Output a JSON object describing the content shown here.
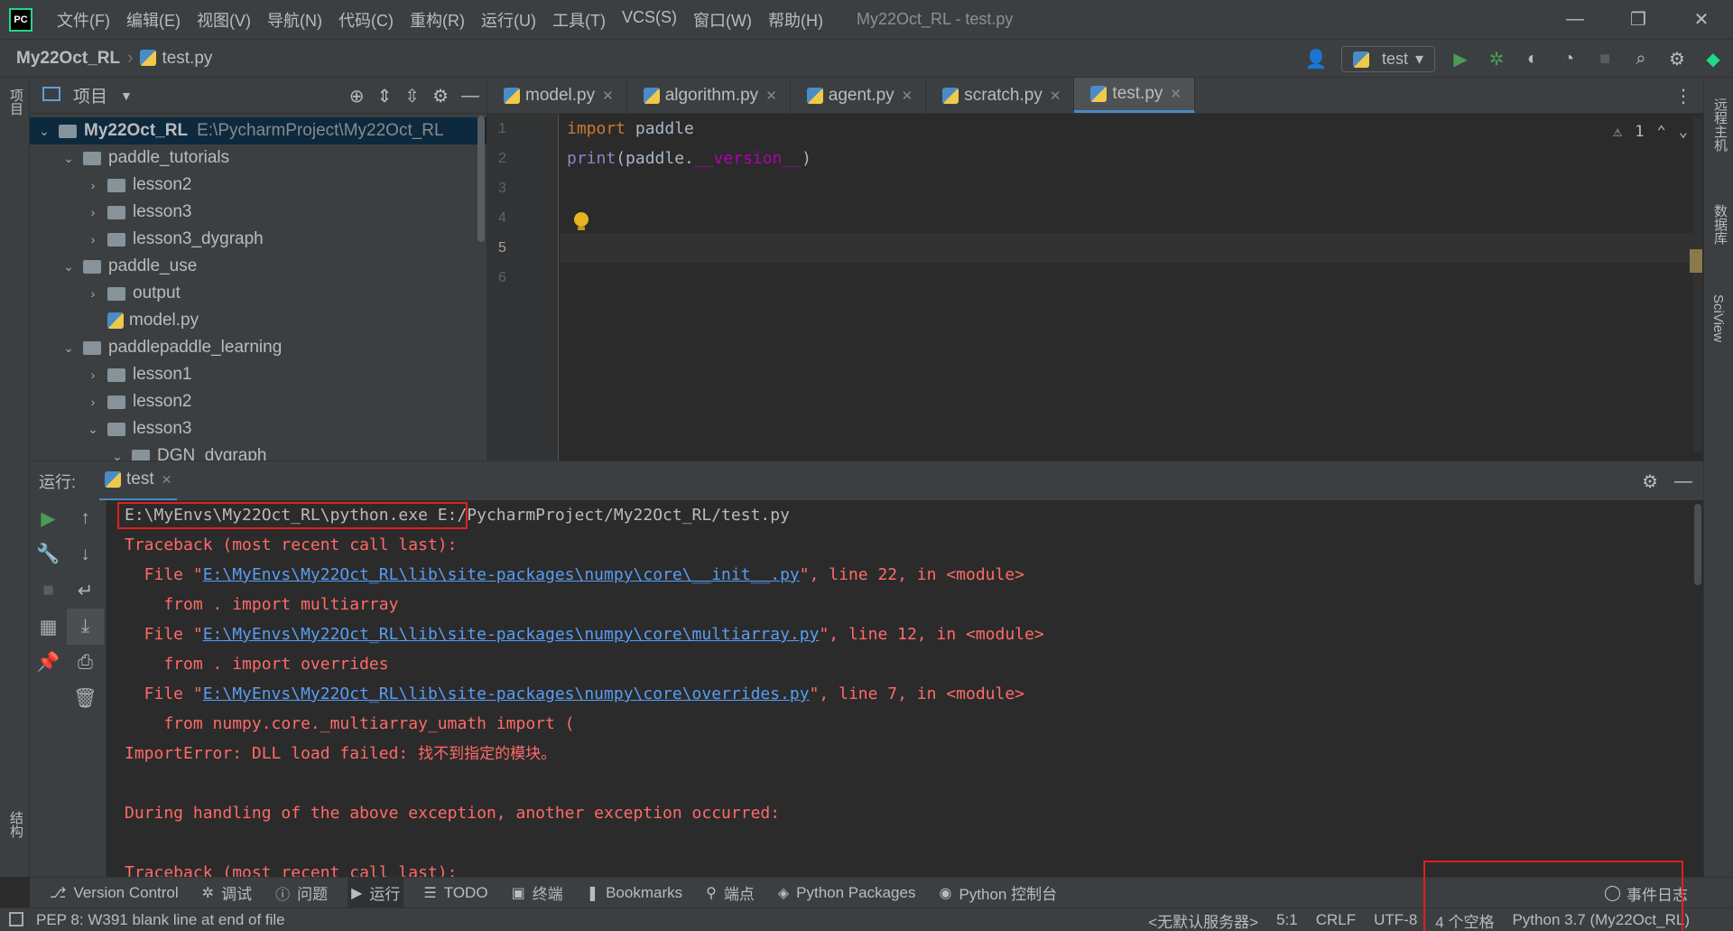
{
  "window": {
    "title": "My22Oct_RL - test.py",
    "menu": [
      "文件(F)",
      "编辑(E)",
      "视图(V)",
      "导航(N)",
      "代码(C)",
      "重构(R)",
      "运行(U)",
      "工具(T)",
      "VCS(S)",
      "窗口(W)",
      "帮助(H)"
    ],
    "controls": {
      "minimize": "—",
      "restore": "❐",
      "close": "✕"
    }
  },
  "navbar": {
    "project": "My22Oct_RL",
    "file": "test.py",
    "run_config": "test"
  },
  "left_stripe": {
    "project_tab": "项目",
    "structure_tab": "结构"
  },
  "right_stripe": {
    "remote_tab": "远程主机",
    "db_tab": "数据库",
    "sciview_tab": "SciView"
  },
  "project_panel": {
    "title": "项目",
    "tree": [
      {
        "label": "My22Oct_RL",
        "path": "E:\\PycharmProject\\My22Oct_RL",
        "arrow": "⌄",
        "depth": 0,
        "type": "root"
      },
      {
        "label": "paddle_tutorials",
        "arrow": "⌄",
        "depth": 1,
        "type": "folder"
      },
      {
        "label": "lesson2",
        "arrow": "›",
        "depth": 2,
        "type": "folder"
      },
      {
        "label": "lesson3",
        "arrow": "›",
        "depth": 2,
        "type": "folder"
      },
      {
        "label": "lesson3_dygraph",
        "arrow": "›",
        "depth": 2,
        "type": "folder"
      },
      {
        "label": "paddle_use",
        "arrow": "⌄",
        "depth": 1,
        "type": "folder"
      },
      {
        "label": "output",
        "arrow": "›",
        "depth": 2,
        "type": "folder"
      },
      {
        "label": "model.py",
        "arrow": "",
        "depth": 2,
        "type": "file"
      },
      {
        "label": "paddlepaddle_learning",
        "arrow": "⌄",
        "depth": 1,
        "type": "folder"
      },
      {
        "label": "lesson1",
        "arrow": "›",
        "depth": 2,
        "type": "folder"
      },
      {
        "label": "lesson2",
        "arrow": "›",
        "depth": 2,
        "type": "folder"
      },
      {
        "label": "lesson3",
        "arrow": "⌄",
        "depth": 2,
        "type": "folder"
      },
      {
        "label": "DGN_dygraph",
        "arrow": "⌄",
        "depth": 3,
        "type": "folder"
      }
    ]
  },
  "editor": {
    "tabs": [
      {
        "label": "model.py",
        "active": false
      },
      {
        "label": "algorithm.py",
        "active": false
      },
      {
        "label": "agent.py",
        "active": false
      },
      {
        "label": "scratch.py",
        "active": false
      },
      {
        "label": "test.py",
        "active": true
      }
    ],
    "warnings": "1",
    "line_numbers": [
      "1",
      "2",
      "3",
      "4",
      "5",
      "6"
    ],
    "current_line": 5,
    "code": {
      "l1_kw": "import",
      "l1_rest": " paddle",
      "l2_fn": "print",
      "l2_a": "(paddle.",
      "l2_dunder": "__version__",
      "l2_b": ")"
    }
  },
  "run_panel": {
    "label": "运行:",
    "tab": "test",
    "console": {
      "exe": "E:\\MyEnvs\\My22Oct_RL\\python.exe",
      "script": " E:/PycharmProject/My22Oct_RL/test.py",
      "tb1": "Traceback (most recent call last):",
      "f1_pre": "  File \"",
      "f1_link": "E:\\MyEnvs\\My22Oct_RL\\lib\\site-packages\\numpy\\core\\__init__.py",
      "f1_post": "\", line 22, in <module>",
      "f1_code": "    from . import multiarray",
      "f2_pre": "  File \"",
      "f2_link": "E:\\MyEnvs\\My22Oct_RL\\lib\\site-packages\\numpy\\core\\multiarray.py",
      "f2_post": "\", line 12, in <module>",
      "f2_code": "    from . import overrides",
      "f3_pre": "  File \"",
      "f3_link": "E:\\MyEnvs\\My22Oct_RL\\lib\\site-packages\\numpy\\core\\overrides.py",
      "f3_post": "\", line 7, in <module>",
      "f3_code": "    from numpy.core._multiarray_umath import (",
      "err_pre": "ImportError: DLL load failed: ",
      "err_cn": "找不到指定的模块。",
      "during": "During handling of the above exception, another exception occurred:",
      "tb2": "Traceback (most recent call last):"
    }
  },
  "bottom_tools": [
    {
      "label": "Version Control",
      "icon": "⎇"
    },
    {
      "label": "调试",
      "icon": "✲"
    },
    {
      "label": "问题",
      "icon": "ⓘ"
    },
    {
      "label": "运行",
      "icon": "▶",
      "active": true
    },
    {
      "label": "TODO",
      "icon": "☰"
    },
    {
      "label": "终端",
      "icon": "▣"
    },
    {
      "label": "Bookmarks",
      "icon": "❚"
    },
    {
      "label": "端点",
      "icon": "⚲"
    },
    {
      "label": "Python Packages",
      "icon": "◈"
    },
    {
      "label": "Python 控制台",
      "icon": "◉"
    }
  ],
  "event_log": "事件日志",
  "status": {
    "message": "PEP 8: W391 blank line at end of file",
    "server": "<无默认服务器>",
    "position": "5:1",
    "line_sep": "CRLF",
    "encoding": "UTF-8",
    "indent": "4 个空格",
    "interpreter": "Python 3.7 (My22Oct_RL)"
  },
  "colors": {
    "accent": "#4a88c7",
    "error": "#ff6b68",
    "link": "#589df6",
    "highlight_box": "#e02020"
  }
}
